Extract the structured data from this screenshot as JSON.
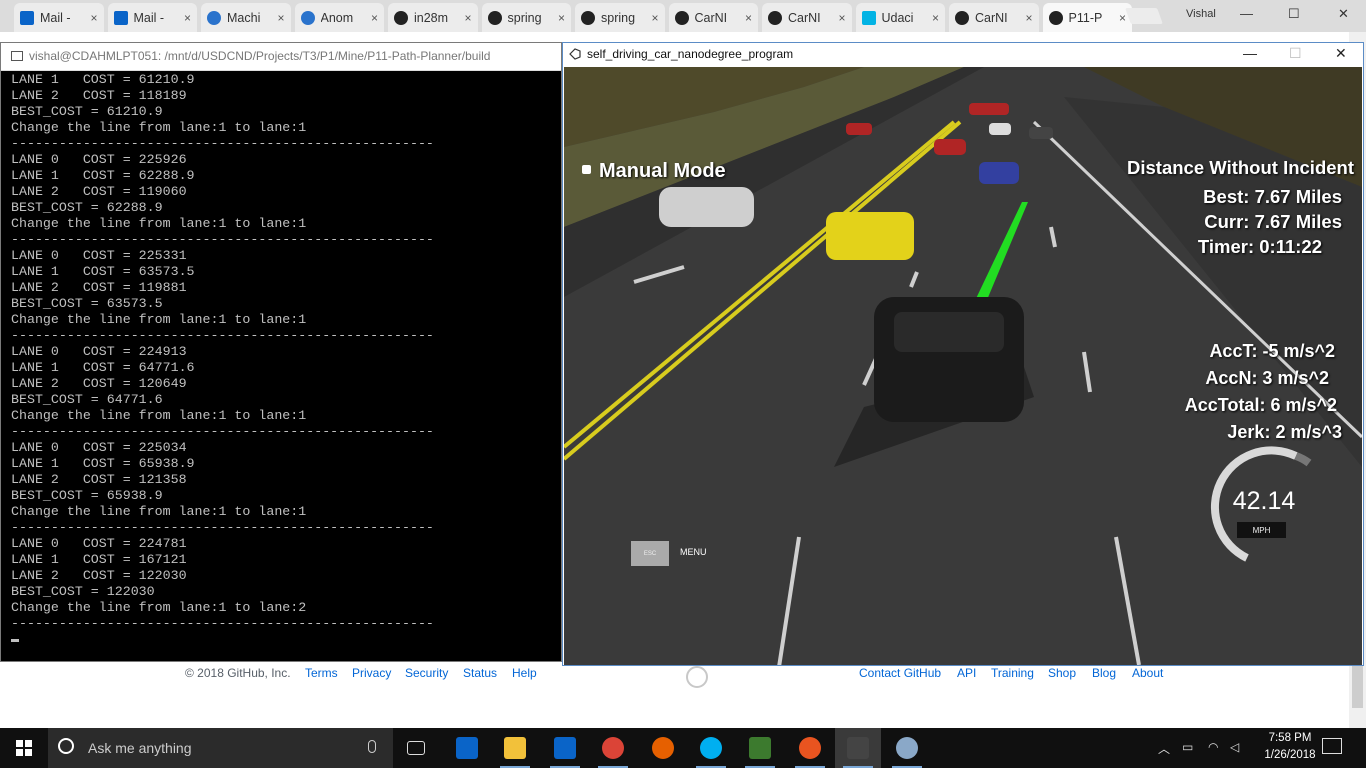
{
  "browser": {
    "tabs": [
      {
        "label": "Mail -",
        "icon": "outlook-icon"
      },
      {
        "label": "Mail -",
        "icon": "outlook-icon"
      },
      {
        "label": "Machi",
        "icon": "coursera-icon"
      },
      {
        "label": "Anom",
        "icon": "coursera-icon"
      },
      {
        "label": "in28m",
        "icon": "github-icon"
      },
      {
        "label": "spring",
        "icon": "github-icon"
      },
      {
        "label": "spring",
        "icon": "github-icon"
      },
      {
        "label": "CarNI",
        "icon": "github-icon"
      },
      {
        "label": "CarNI",
        "icon": "github-icon"
      },
      {
        "label": "Udaci",
        "icon": "udacity-icon"
      },
      {
        "label": "CarNI",
        "icon": "github-icon"
      },
      {
        "label": "P11-P",
        "icon": "github-icon"
      }
    ],
    "tab_close_glyph": "×",
    "profile_name": "Vishal",
    "controls": {
      "minimize": "—",
      "maximize": "☐",
      "close": "✕"
    }
  },
  "github_footer": {
    "copyright": "© 2018 GitHub, Inc.",
    "left_links": [
      "Terms",
      "Privacy",
      "Security",
      "Status",
      "Help"
    ],
    "right_links": [
      "Contact GitHub",
      "API",
      "Training",
      "Shop",
      "Blog",
      "About"
    ]
  },
  "terminal": {
    "title": "vishal@CDAHMLPT051: /mnt/d/USDCND/Projects/T3/P1/Mine/P11-Path-Planner/build",
    "lines": [
      "LANE 1   COST = 61210.9",
      "LANE 2   COST = 118189",
      "BEST_COST = 61210.9",
      "Change the line from lane:1 to lane:1",
      "-----------------------------------------------------",
      "LANE 0   COST = 225926",
      "LANE 1   COST = 62288.9",
      "LANE 2   COST = 119060",
      "BEST_COST = 62288.9",
      "Change the line from lane:1 to lane:1",
      "-----------------------------------------------------",
      "LANE 0   COST = 225331",
      "LANE 1   COST = 63573.5",
      "LANE 2   COST = 119881",
      "BEST_COST = 63573.5",
      "Change the line from lane:1 to lane:1",
      "-----------------------------------------------------",
      "LANE 0   COST = 224913",
      "LANE 1   COST = 64771.6",
      "LANE 2   COST = 120649",
      "BEST_COST = 64771.6",
      "Change the line from lane:1 to lane:1",
      "-----------------------------------------------------",
      "LANE 0   COST = 225034",
      "LANE 1   COST = 65938.9",
      "LANE 2   COST = 121358",
      "BEST_COST = 65938.9",
      "Change the line from lane:1 to lane:1",
      "-----------------------------------------------------",
      "LANE 0   COST = 224781",
      "LANE 1   COST = 167121",
      "LANE 2   COST = 122030",
      "BEST_COST = 122030",
      "Change the line from lane:1 to lane:2",
      "-----------------------------------------------------"
    ]
  },
  "simulator": {
    "title": "self_driving_car_nanodegree_program",
    "controls": {
      "minimize": "—",
      "maximize": "☐",
      "close": "✕"
    },
    "manual_mode_label": "Manual Mode",
    "distance_heading": "Distance Without Incident",
    "best": "Best: 7.67 Miles",
    "curr": "Curr: 7.67 Miles",
    "timer": "Timer: 0:11:22",
    "acc_t": "AccT: -5 m/s^2",
    "acc_n": "AccN: 3 m/s^2",
    "acc_total": "AccTotal: 6 m/s^2",
    "jerk": "Jerk: 2 m/s^3",
    "speed": "42.14",
    "speed_unit": "MPH",
    "esc_label": "ESC",
    "menu_label": "MENU",
    "colors": {
      "path": "#22dd22",
      "lane_yellow": "#d8cc1e",
      "road": "#3a3a3a",
      "hill": "#4f4a2a"
    }
  },
  "taskbar": {
    "search_placeholder": "Ask me anything",
    "apps": [
      "task-view-icon",
      "store-icon",
      "file-explorer-icon",
      "outlook-icon",
      "chrome-icon",
      "firefox-icon",
      "skype-icon",
      "task-manager-icon",
      "ubuntu-icon",
      "unity-icon",
      "paint-icon"
    ],
    "time": "7:58 PM",
    "date": "1/26/2018"
  }
}
